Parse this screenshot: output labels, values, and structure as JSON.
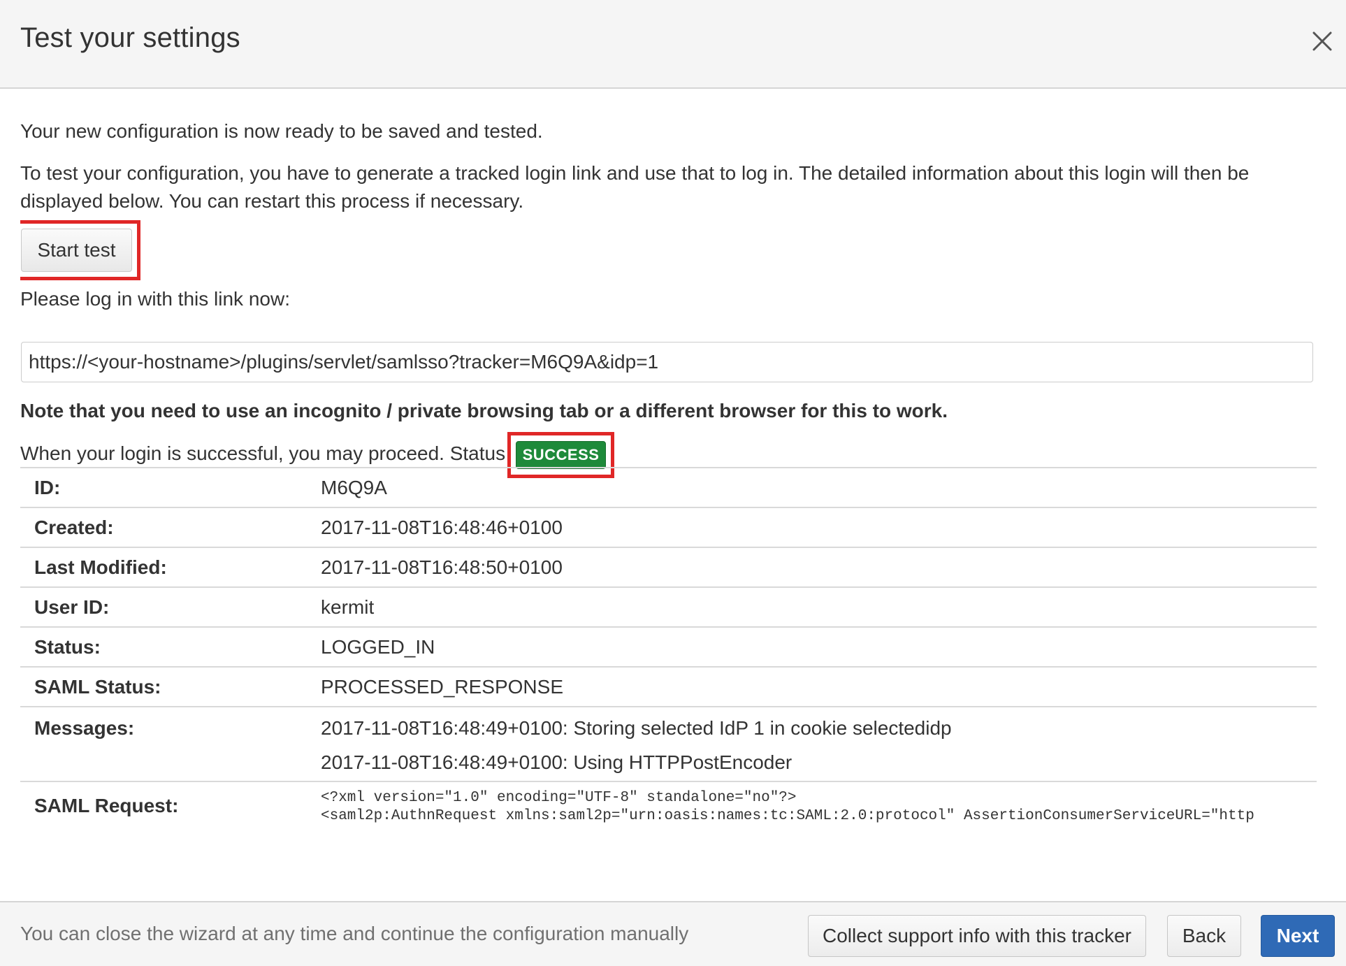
{
  "header": {
    "title": "Test your settings",
    "close_icon": "close-icon"
  },
  "intro": {
    "ready": "Your new configuration is now ready to be saved and tested.",
    "instructions": "To test your configuration, you have to generate a tracked login link and use that to log in. The detailed information about this login will then be displayed below. You can restart this process if necessary."
  },
  "start_test_label": "Start test",
  "login_prompt": "Please log in with this link now:",
  "login_link": "https://<your-hostname>/plugins/servlet/samlsso?tracker=M6Q9A&idp=1",
  "note": "Note that you need to use an incognito / private browsing tab or a different browser for this to work.",
  "status_line": "When your login is successful, you may proceed. Status",
  "status_badge": {
    "label": "SUCCESS",
    "color": "#1e8a3a"
  },
  "details": {
    "id": {
      "key": "ID:",
      "value": "M6Q9A"
    },
    "created": {
      "key": "Created:",
      "value": "2017-11-08T16:48:46+0100"
    },
    "last_modified": {
      "key": "Last Modified:",
      "value": "2017-11-08T16:48:50+0100"
    },
    "user_id": {
      "key": "User ID:",
      "value": "kermit"
    },
    "status": {
      "key": "Status:",
      "value": "LOGGED_IN"
    },
    "saml_status": {
      "key": "SAML Status:",
      "value": "PROCESSED_RESPONSE"
    },
    "messages": {
      "key": "Messages:",
      "items": [
        "2017-11-08T16:48:49+0100: Storing selected IdP 1 in cookie selectedidp",
        "2017-11-08T16:48:49+0100: Using HTTPPostEncoder"
      ]
    },
    "saml_request": {
      "key": "SAML Request:",
      "lines": [
        "<?xml version=\"1.0\" encoding=\"UTF-8\" standalone=\"no\"?>",
        "<saml2p:AuthnRequest xmlns:saml2p=\"urn:oasis:names:tc:SAML:2.0:protocol\" AssertionConsumerServiceURL=\"http"
      ]
    }
  },
  "footer": {
    "hint": "You can close the wizard at any time and continue the configuration manually",
    "collect_label": "Collect support info with this tracker",
    "back_label": "Back",
    "next_label": "Next"
  },
  "colors": {
    "accent": "#2f6ab6",
    "highlight": "#e02727",
    "success": "#1e8a3a"
  }
}
